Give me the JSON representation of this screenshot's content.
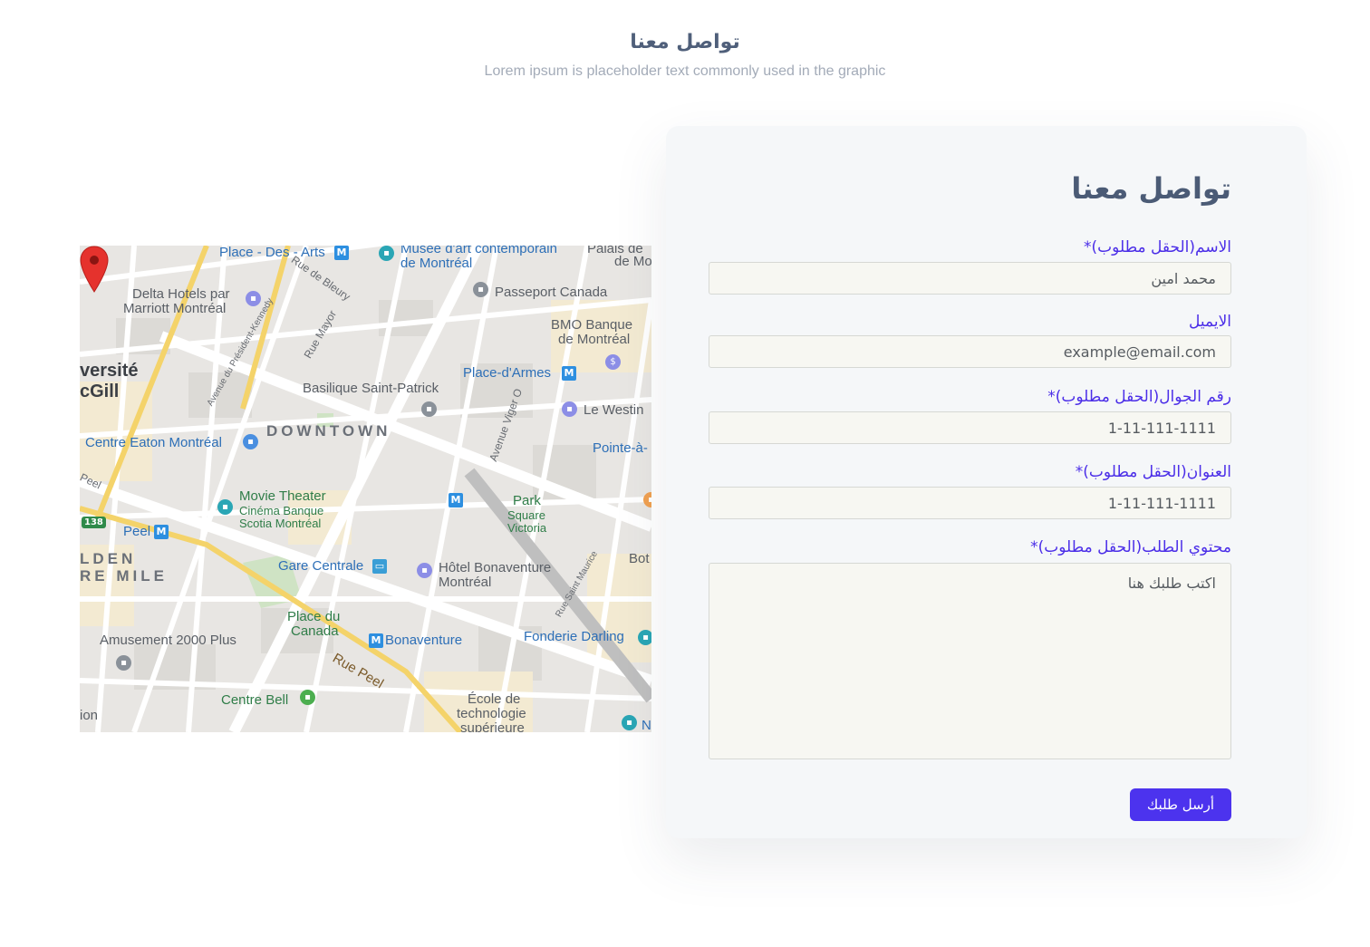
{
  "header": {
    "title": "تواصل معنا",
    "subtitle": "Lorem ipsum is placeholder text commonly used in the graphic"
  },
  "map": {
    "labels": {
      "place_des_arts": "Place - Des - Arts",
      "musee_1": "Musée d'art contemporain",
      "musee_2": "de Montréal",
      "palais_1": "Palais de",
      "palais_2": "de Mo",
      "rue_bleury": "Rue de Bleury",
      "delta_1": "Delta Hotels par",
      "delta_2": "Marriott Montréal",
      "passeport": "Passeport Canada",
      "bmo_1": "BMO Banque",
      "bmo_2": "de Montréal",
      "rue_mayor": "Rue Mayor",
      "mcgill_1": "versité",
      "mcgill_2": "cGill",
      "av_president": "Avenue du Président-Kennedy",
      "place_darmes": "Place-d'Armes",
      "basilique": "Basilique Saint-Patrick",
      "av_viger": "Avenue Viger O",
      "westin": "Le Westin",
      "downtown": "DOWNTOWN",
      "eaton": "Centre Eaton Montréal",
      "pointe": "Pointe-à-",
      "peel_street": "Peel",
      "movie_1": "Movie Theater",
      "movie_2": "Cinéma Banque",
      "movie_3": "Scotia Montréal",
      "park_1": "Park",
      "park_2": "Square",
      "park_3": "Victoria",
      "hwy": "138",
      "peel_metro": "Peel",
      "golden_1": "LDEN",
      "golden_2": "RE MILE",
      "gare": "Gare Centrale",
      "hotel_1": "Hôtel Bonaventure",
      "hotel_2": "Montréal",
      "bot": "Bot",
      "rue_st_maurice": "Rue Saint Maurice",
      "canada_1": "Place du",
      "canada_2": "Canada",
      "amusement": "Amusement 2000 Plus",
      "bonaventure": "Bonaventure",
      "fonderie": "Fonderie Darling",
      "rue_peel": "Rue Peel",
      "centre_bell": "Centre Bell",
      "ecole_1": "École de",
      "ecole_2": "technologie",
      "ecole_3": "supérieure",
      "ion": "ion",
      "n": "N",
      "metro_symbol": "M"
    }
  },
  "form": {
    "title": "تواصل معنا",
    "name_label": "الاسم(الحقل مطلوب)*",
    "name_value": "محمد امين",
    "email_label": "الايميل",
    "email_value": "example@email.com",
    "phone_label": "رقم الجوال(الحقل مطلوب)*",
    "phone_value": "1-11-111-1111",
    "address_label": "العنوان(الحقل مطلوب)*",
    "address_value": "1-11-111-1111",
    "content_label": "محتوي الطلب(الحقل مطلوب)*",
    "content_placeholder": "اكتب طلبك هنا",
    "submit_label": "أرسل  طلبك"
  },
  "colors": {
    "accent": "#4c33ee",
    "title": "#4b5b76"
  }
}
